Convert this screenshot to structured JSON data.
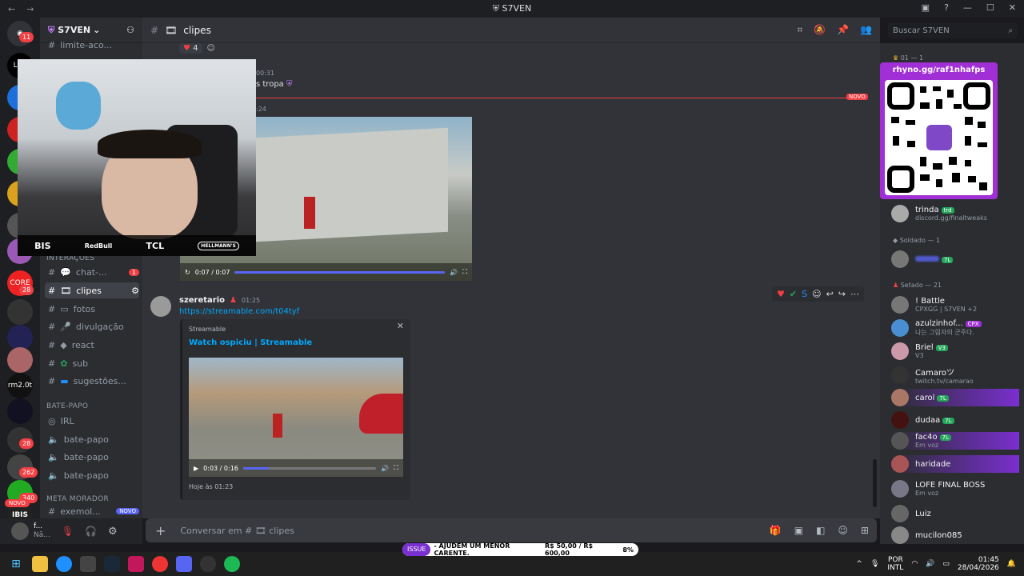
{
  "window": {
    "title": "S7VEN",
    "back": "←",
    "forward": "→"
  },
  "server": {
    "name": "S7VEN",
    "badge_count": "11"
  },
  "channel": {
    "name": "clipes",
    "prefix": "#"
  },
  "search": {
    "placeholder": "Buscar S7VEN"
  },
  "channels": {
    "top_item": "limite-aco...",
    "category_interacoes": "INTERAÇÕES",
    "items": [
      {
        "label": "chat-...",
        "badge": "1"
      },
      {
        "label": "clipes"
      },
      {
        "label": "fotos"
      },
      {
        "label": "divulgação"
      },
      {
        "label": "react"
      },
      {
        "label": "sub"
      },
      {
        "label": "sugestões..."
      }
    ],
    "category_batepapo": "BATE-PAPO",
    "voice": [
      {
        "label": "IRL"
      },
      {
        "label": "bate-papo"
      },
      {
        "label": "bate-papo"
      },
      {
        "label": "bate-papo"
      }
    ],
    "category_meta": "META MORADOR",
    "meta_item": "exemol...",
    "novo_badge": "NOVO"
  },
  "user": {
    "name": "f...",
    "status": "Nã..."
  },
  "server_badges": [
    "28",
    "28",
    "262",
    "340"
  ],
  "server_labels": [
    "LUE",
    "CORE",
    "rm2.0t",
    "IBIS"
  ],
  "novo_pill": "NOVO",
  "messages": {
    "reaction_count": "4",
    "prev_time": "00:31",
    "prev_text": "s tropa",
    "prev_time2": ":24",
    "new_divider": "NOVO",
    "video1": {
      "time": "0:07 / 0:07",
      "progress": 1.0
    },
    "author": "szeretario",
    "time": "01:25",
    "link": "https://streamable.com/t04tyf",
    "embed": {
      "provider": "Streamable",
      "title": "Watch ospiciu | Streamable",
      "video_time": "0:03 / 0:16",
      "progress": 0.19,
      "footer": "Hoje às 01:23"
    }
  },
  "stream_overlay": {
    "logos": [
      "BIS",
      "RedBull",
      "TCL",
      "HELLMANN'S"
    ]
  },
  "composer": {
    "placeholder": "Conversar em #",
    "channel": "clipes"
  },
  "members": {
    "header_top": "01 — 1",
    "promo": "rhyno.gg/raf1nhafps",
    "trinda": {
      "name": "trinda",
      "tag": "trd",
      "sub": "discord.gg/finaltweaks"
    },
    "soldado_header": "Soldado — 1",
    "soldado_member_tag": "7L",
    "setado_header": "Setado — 21",
    "list": [
      {
        "name": "! Battle",
        "sub": "CPXGG | S7VEN +2"
      },
      {
        "name": "azulzinhof...",
        "tag": "CPX",
        "sub": "나는 그림자의 군주다."
      },
      {
        "name": "Briel",
        "tag": "V3",
        "sub": "V3"
      },
      {
        "name": "Camaroツ",
        "sub": "twitch.tv/camarao"
      },
      {
        "name": "carol",
        "tag": "7L"
      },
      {
        "name": "dudaa",
        "tag": "7L"
      },
      {
        "name": "fac4o",
        "tag": "7L",
        "sub": "Em voz"
      },
      {
        "name": "haridade"
      },
      {
        "name": "LOFE FINAL BOSS",
        "sub": "Em voz"
      },
      {
        "name": "Luiz"
      },
      {
        "name": "mucilon085"
      }
    ]
  },
  "taskbar": {
    "ticker_tag": "ISSUE",
    "ticker": "- AJUDEM UM MENOR CARENTE.",
    "goal": "R$ 50,00 / R$ 600,00",
    "goal_pct": "8%",
    "lang_top": "POR",
    "lang_bottom": "INTL",
    "clock": "01:45",
    "date": "28/04/2026"
  }
}
